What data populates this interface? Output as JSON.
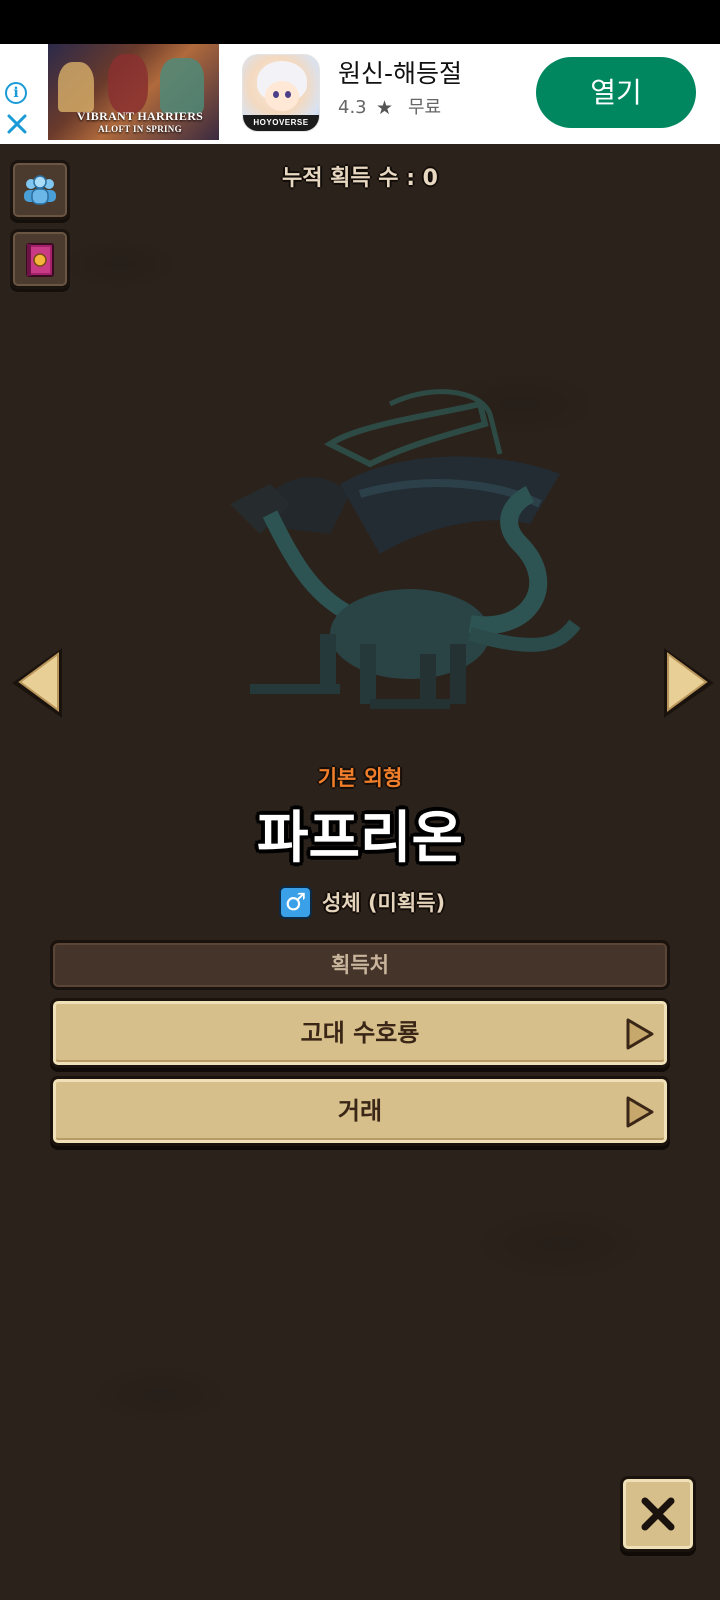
{
  "ad": {
    "info_icon": "info-icon",
    "close_icon": "close-x-icon",
    "image_caption": "VIBRANT HARRIERS",
    "image_caption2": "ALOFT IN SPRING",
    "app_brand": "HOYOVERSE",
    "app_title": "원신-해등절",
    "rating": "4.3",
    "star": "★",
    "price": "무료",
    "open_label": "열기",
    "open_color": "#01875f"
  },
  "game": {
    "total_count_label": "누적 획득 수 : 0",
    "side_buttons": [
      {
        "name": "community-button",
        "icon": "group-icon"
      },
      {
        "name": "book-button",
        "icon": "book-icon"
      }
    ],
    "form_label": "기본 외형",
    "creature_name": "파프리온",
    "gender_symbol": "♂",
    "gender_status": "성체 (미획득)",
    "source_header": "획득처",
    "sources": [
      {
        "label": "고대 수호룡"
      },
      {
        "label": "거래"
      }
    ],
    "colors": {
      "background": "#2b221b",
      "form_label": "#f07e2a",
      "button_fill": "#d7bf8c",
      "gender_icon": "#3aa0e8"
    }
  }
}
